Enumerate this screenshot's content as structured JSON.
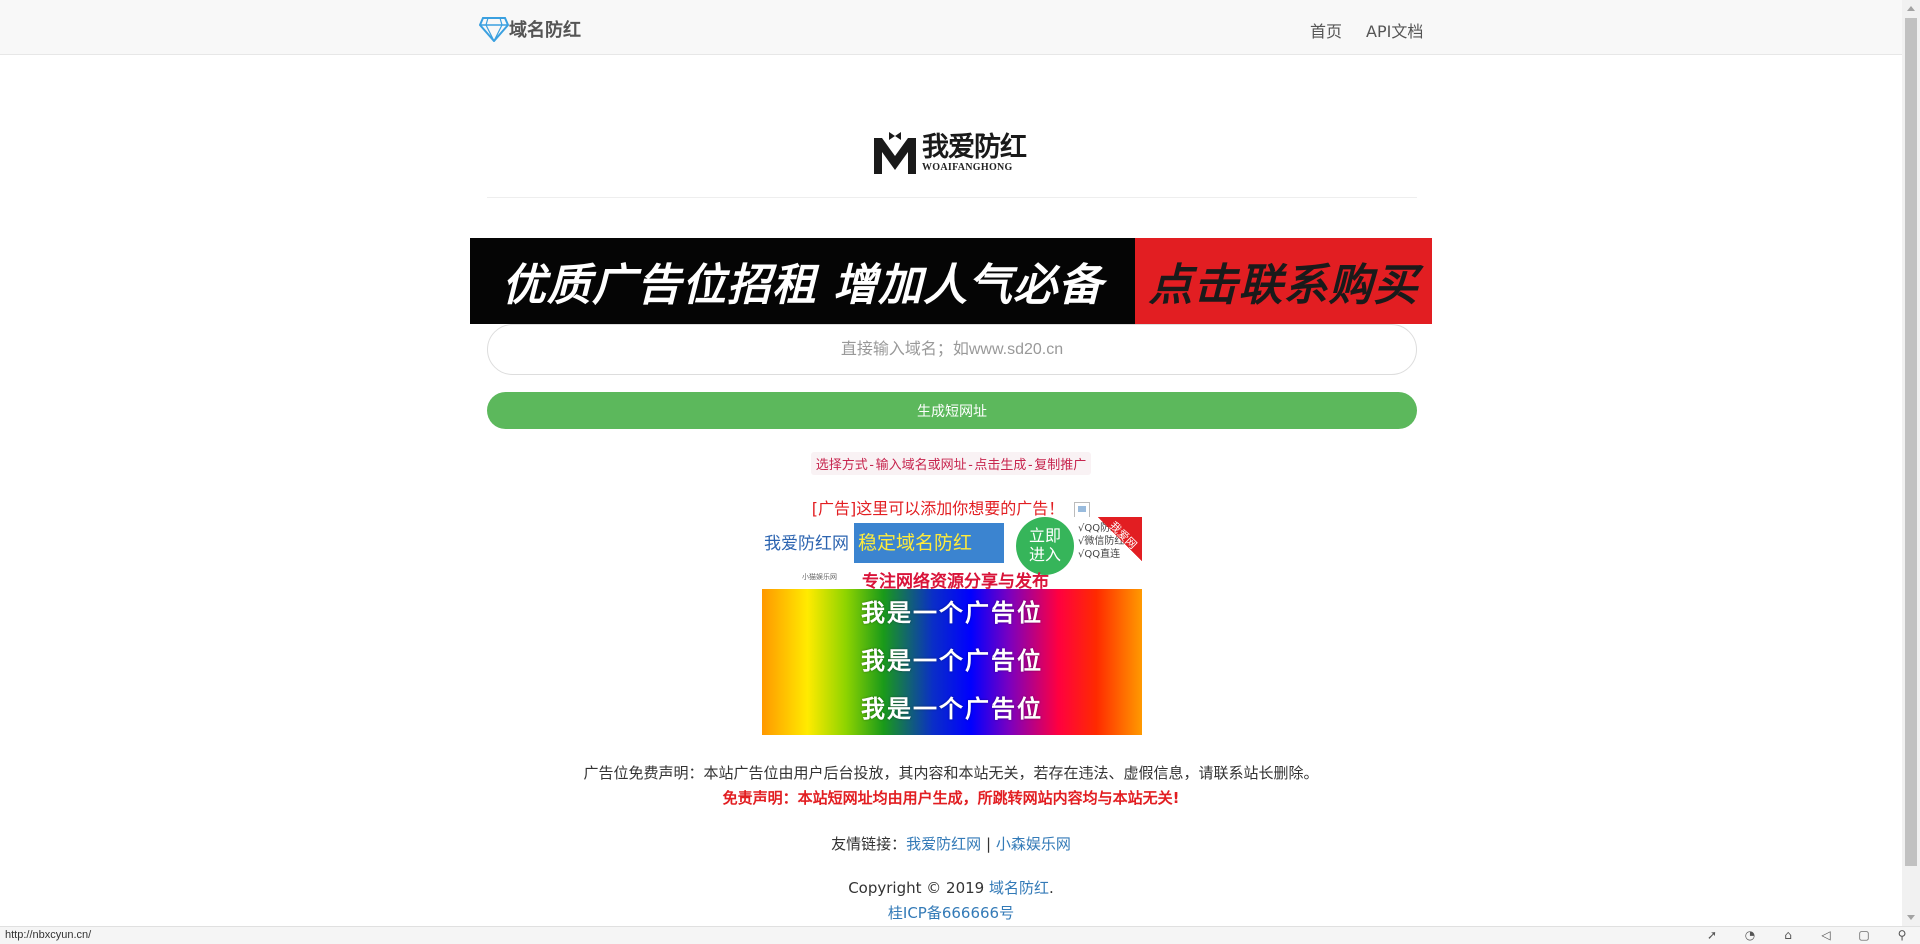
{
  "navbar": {
    "brand": "域名防红",
    "links": [
      "首页",
      "API文档"
    ]
  },
  "logo": {
    "cn": "我爱防红",
    "en": "WOAIFANGHONG"
  },
  "banner": {
    "left": "优质广告位招租 增加人气必备",
    "right": "点击联系购买"
  },
  "form": {
    "placeholder": "直接输入域名；如www.sd20.cn",
    "value": "",
    "button": "生成短网址"
  },
  "steps": "选择方式-输入域名或网址-点击生成-复制推广",
  "ad_note": "[广告]这里可以添加你想要的广告！",
  "ad1": {
    "brand": "我爱防红网",
    "headline": "稳定域名防红",
    "circle": [
      "立即",
      "进入"
    ],
    "list": [
      "√QQ防红",
      "√微信防红",
      "√QQ直连"
    ],
    "corner": "我爱网",
    "sub_small": "小猫娱乐网",
    "sub": "专注网络资源分享与发布"
  },
  "ad2": [
    "我是一个广告位",
    "我是一个广告位",
    "我是一个广告位"
  ],
  "disclaimer": "广告位免费声明：本站广告位由用户后台投放，其内容和本站无关，若存在违法、虚假信息，请联系站长删除。",
  "disclaimer2": "免责声明：本站短网址均由用户生成，所跳转网站内容均与本站无关!",
  "friends": {
    "label": "友情链接：",
    "links": [
      "我爱防红网",
      "小森娱乐网"
    ],
    "sep": "|"
  },
  "footer": {
    "copy": "Copyright © 2019 ",
    "copy_link": "域名防红",
    "copy_end": ".",
    "icp": "桂ICP备666666号"
  },
  "status": {
    "url": "http://nbxcyun.cn/",
    "icons": [
      "rocket-icon",
      "speed-icon",
      "trash-icon",
      "volume-icon",
      "window-icon",
      "search-icon"
    ]
  },
  "colors": {
    "green": "#5cb85c",
    "red": "#e21e22",
    "link": "#337ab7"
  }
}
